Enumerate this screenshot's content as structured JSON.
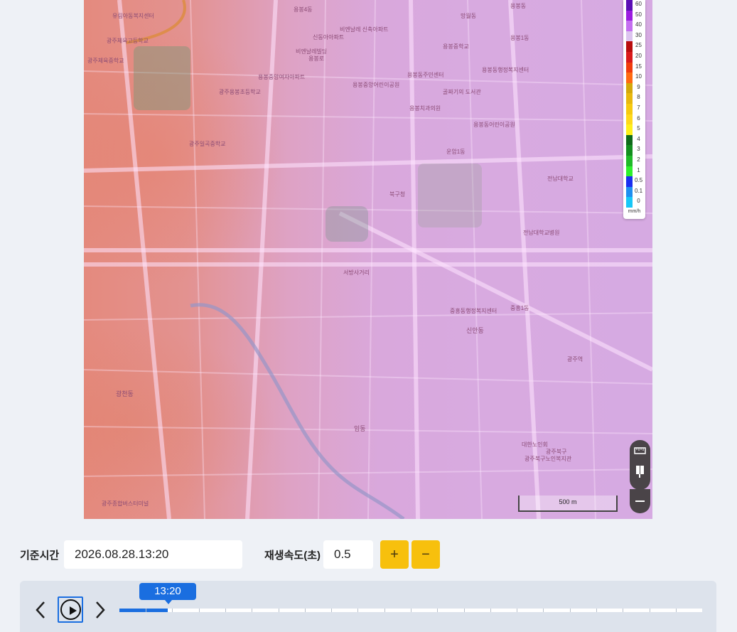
{
  "map": {
    "labels": [
      "유림아동복지센터",
      "용봉4동",
      "용봉동",
      "망월동",
      "광주체육고등학교",
      "광주체육중학교",
      "신동아아파트",
      "비엔날레 신축아파트",
      "비엔날레빌딩",
      "용봉로",
      "용봉1동",
      "용봉동행정복지센터",
      "용봉중앙여자아파트",
      "용봉동주민센터",
      "용봉중학교",
      "광주용봉초등학교",
      "용봉중앙어린이공원",
      "용봉치과의원",
      "용봉동어린이공원",
      "골짜기의 도서관",
      "전남대학교",
      "광주일곡중학교",
      "운암1동",
      "임동",
      "광천동",
      "광주종합버스터미널",
      "신안동",
      "중흥1동",
      "중흥동행정복지센터",
      "서방사거리",
      "북구청",
      "광주역",
      "전남대학교병원",
      "대한노인회",
      "광주북구",
      "광주북구노인복지관"
    ],
    "scale": "500 m"
  },
  "legend": {
    "unit": "mm/h",
    "items": [
      {
        "label": "60",
        "color": "#5b0fb5"
      },
      {
        "label": "50",
        "color": "#9b1de0"
      },
      {
        "label": "40",
        "color": "#c46ff0"
      },
      {
        "label": "30",
        "color": "#dcc4ef"
      },
      {
        "label": "25",
        "color": "#b80d0d"
      },
      {
        "label": "20",
        "color": "#d91a1a"
      },
      {
        "label": "15",
        "color": "#f03c0c"
      },
      {
        "label": "10",
        "color": "#ff6a10"
      },
      {
        "label": "9",
        "color": "#d4a80a"
      },
      {
        "label": "8",
        "color": "#e8b80e"
      },
      {
        "label": "7",
        "color": "#f6ca0f"
      },
      {
        "label": "6",
        "color": "#ffd91a"
      },
      {
        "label": "5",
        "color": "#fff01a"
      },
      {
        "label": "4",
        "color": "#0f6b1a"
      },
      {
        "label": "3",
        "color": "#138f1f"
      },
      {
        "label": "2",
        "color": "#1fba28"
      },
      {
        "label": "1",
        "color": "#2ef02c"
      },
      {
        "label": "0.5",
        "color": "#1a2ef0"
      },
      {
        "label": "0.1",
        "color": "#1f8ff0"
      },
      {
        "label": "0",
        "color": "#17c7f7"
      }
    ]
  },
  "controls": {
    "base_time_label": "기준시간",
    "base_time_value": "2026.08.28.13:20",
    "speed_label": "재생속도(초)",
    "speed_value": "0.5",
    "plus": "+",
    "minus": "−"
  },
  "timeline": {
    "current": "13:20",
    "progress": 0.083,
    "prev": "〈",
    "next": "〉"
  }
}
